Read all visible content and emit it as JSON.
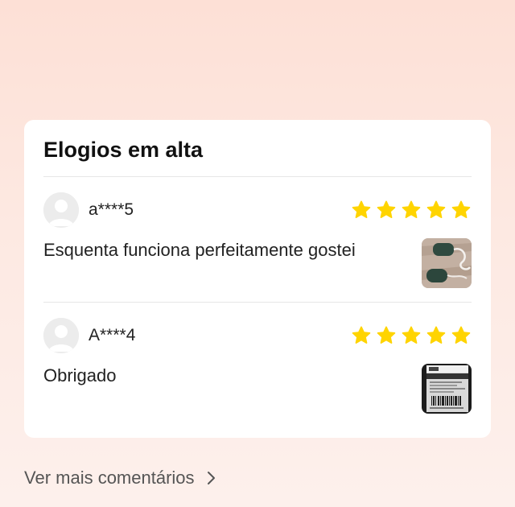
{
  "section": {
    "title": "Elogios em alta"
  },
  "reviews": [
    {
      "username": "a****5",
      "rating": 5,
      "text": "Esquenta funciona perfeitamente gostei",
      "has_photo": true
    },
    {
      "username": "A****4",
      "rating": 5,
      "text": "Obrigado",
      "has_photo": true
    }
  ],
  "footer": {
    "see_more_label": "Ver mais comentários",
    "see_more_icon": "chevron-right-icon"
  },
  "colors": {
    "star": "#ffd400",
    "card_background": "#ffffff",
    "page_gradient_top": "#fde0d6",
    "page_gradient_bottom": "#fdf0ec"
  }
}
